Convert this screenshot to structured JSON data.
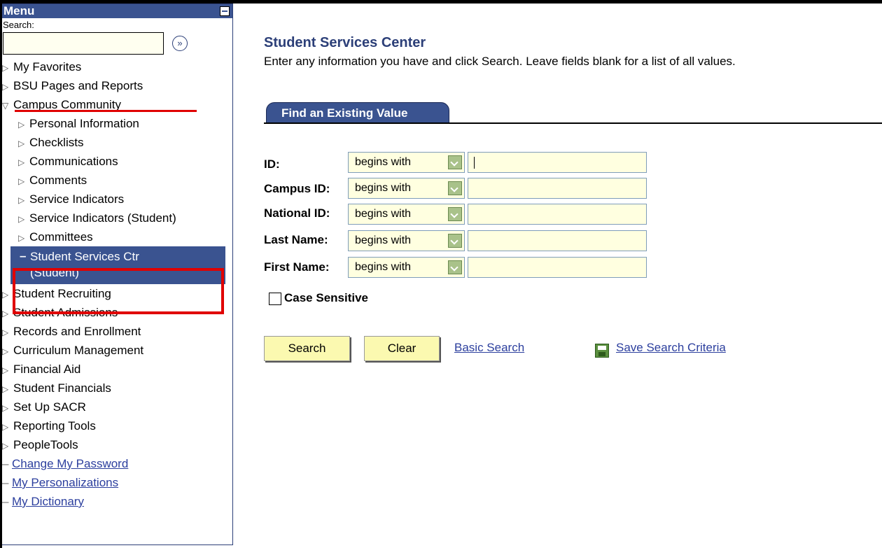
{
  "sidebar": {
    "title": "Menu",
    "search_label": "Search:",
    "search_value": "",
    "go_label": "»",
    "items": [
      {
        "label": "My Favorites",
        "type": "folder"
      },
      {
        "label": "BSU Pages and Reports",
        "type": "folder"
      },
      {
        "label": "Campus Community",
        "type": "folder-open"
      },
      {
        "label": "Personal Information",
        "type": "sub"
      },
      {
        "label": "Checklists",
        "type": "sub"
      },
      {
        "label": "Communications",
        "type": "sub"
      },
      {
        "label": "Comments",
        "type": "sub"
      },
      {
        "label": "Service Indicators",
        "type": "sub"
      },
      {
        "label": "Service Indicators (Student)",
        "type": "sub"
      },
      {
        "label": "Committees",
        "type": "sub"
      },
      {
        "label_line1": "Student Services Ctr",
        "label_line2": "(Student)",
        "type": "selected"
      },
      {
        "label": "Student Recruiting",
        "type": "folder"
      },
      {
        "label": "Student Admissions",
        "type": "folder"
      },
      {
        "label": "Records and Enrollment",
        "type": "folder"
      },
      {
        "label": "Curriculum Management",
        "type": "folder"
      },
      {
        "label": "Financial Aid",
        "type": "folder"
      },
      {
        "label": "Student Financials",
        "type": "folder"
      },
      {
        "label": "Set Up SACR",
        "type": "folder"
      },
      {
        "label": "Reporting Tools",
        "type": "folder"
      },
      {
        "label": "PeopleTools",
        "type": "folder"
      },
      {
        "label": "Change My Password",
        "type": "link"
      },
      {
        "label": "My Personalizations",
        "type": "link"
      },
      {
        "label": "My Dictionary",
        "type": "link"
      }
    ]
  },
  "main": {
    "title": "Student Services Center",
    "instructions": "Enter any information you have and click Search. Leave fields blank for a list of all values.",
    "tab_label": "Find an Existing Value",
    "fields": [
      {
        "label": "ID:",
        "operator": "begins with",
        "value": ""
      },
      {
        "label": "Campus ID:",
        "operator": "begins with",
        "value": ""
      },
      {
        "label": "National ID:",
        "operator": "begins with",
        "value": ""
      },
      {
        "label": "Last Name:",
        "operator": "begins with",
        "value": ""
      },
      {
        "label": "First Name:",
        "operator": "begins with",
        "value": ""
      }
    ],
    "case_sensitive_label": "Case Sensitive",
    "case_sensitive_checked": false,
    "search_button": "Search",
    "clear_button": "Clear",
    "basic_search_link": "Basic Search",
    "save_search_link": "Save Search Criteria"
  },
  "colors": {
    "header_blue": "#3a5390",
    "title_blue": "#2c3f78",
    "link_blue": "#2c3f9e",
    "button_yellow": "#fbf9b0",
    "input_bg": "#ffffe0",
    "highlight_red": "#e00000"
  },
  "icons": {
    "collapse": "minus-box-icon",
    "go": "double-chevron-circle-icon",
    "folder_closed": "triangle-right-icon",
    "folder_open": "triangle-down-icon",
    "dropdown": "chevron-down-icon",
    "save": "floppy-disk-icon"
  }
}
